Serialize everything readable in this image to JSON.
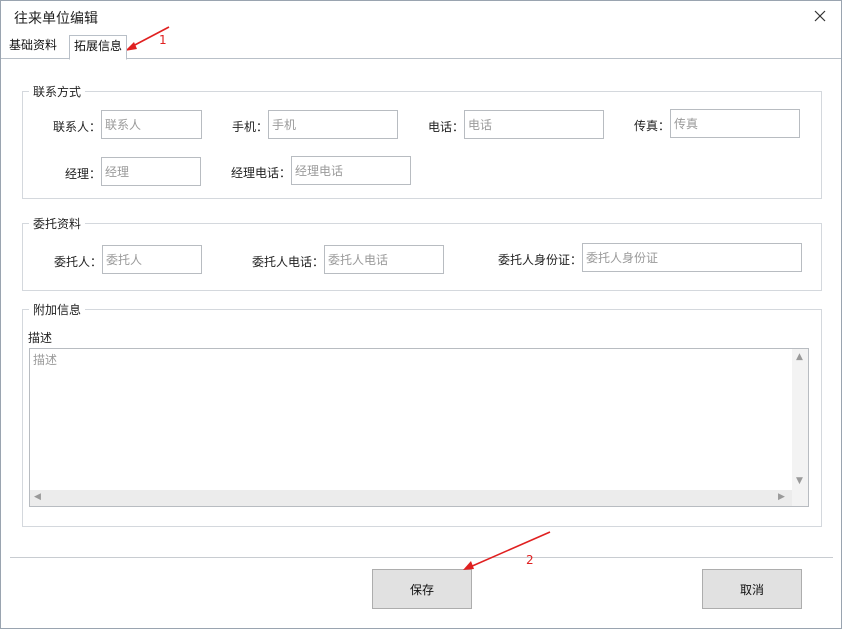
{
  "window": {
    "title": "往来单位编辑",
    "close_glyph": "✕"
  },
  "tabs": [
    {
      "label": "基础资料"
    },
    {
      "label": "拓展信息",
      "active": true
    }
  ],
  "contact": {
    "legend": "联系方式",
    "contact_person": {
      "label": "联系人：",
      "placeholder": "联系人"
    },
    "mobile": {
      "label": "手机：",
      "placeholder": "手机"
    },
    "phone": {
      "label": "电话：",
      "placeholder": "电话"
    },
    "fax": {
      "label": "传真：",
      "placeholder": "传真"
    },
    "manager": {
      "label": "经理：",
      "placeholder": "经理"
    },
    "manager_phone": {
      "label": "经理电话：",
      "placeholder": "经理电话"
    }
  },
  "entrust": {
    "legend": "委托资料",
    "entrust_person": {
      "label": "委托人：",
      "placeholder": "委托人"
    },
    "entrust_phone": {
      "label": "委托人电话：",
      "placeholder": "委托人电话"
    },
    "entrust_id": {
      "label": "委托人身份证：",
      "placeholder": "委托人身份证"
    }
  },
  "extra": {
    "legend": "附加信息",
    "description": {
      "label": "描述",
      "placeholder": "描述"
    }
  },
  "footer": {
    "save_label": "保存",
    "cancel_label": "取消"
  },
  "annotations": {
    "marker_1": "1",
    "marker_2": "2",
    "color": "#e02020"
  },
  "colors": {
    "border": "#b8bcc1",
    "button_bg": "#e1e1e1"
  }
}
